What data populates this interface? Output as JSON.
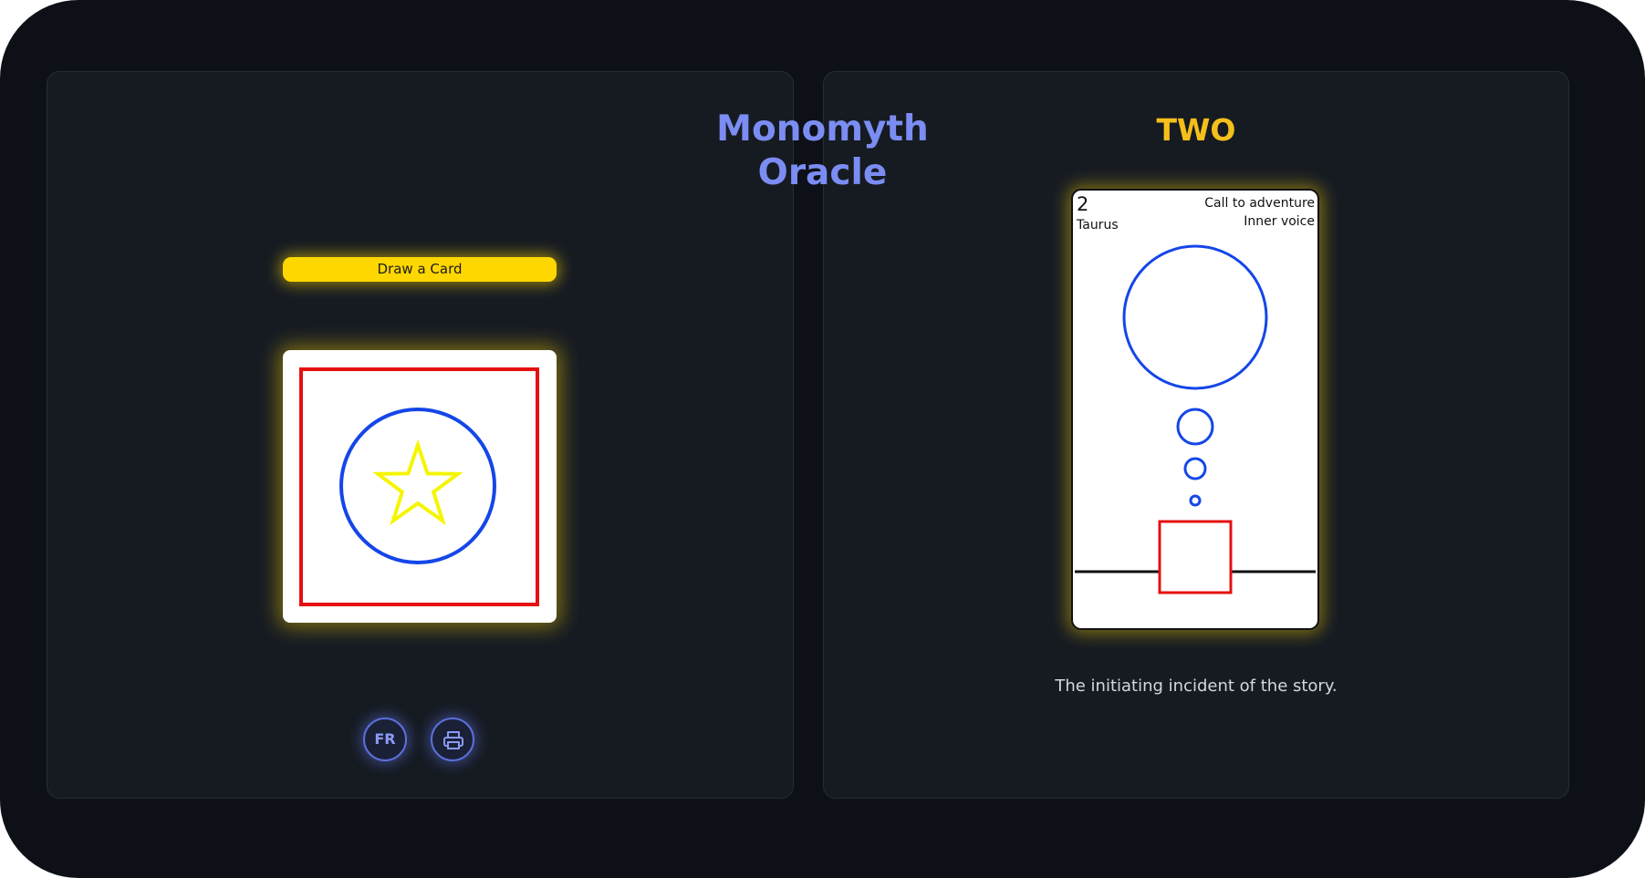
{
  "app": {
    "title_line1": "Monomyth",
    "title_line2": "Oracle",
    "draw_button_label": "Draw a Card",
    "card_back_icon": "star-in-circle-in-square",
    "lang_button_label": "FR",
    "print_icon": "printer-icon"
  },
  "drawn_card": {
    "title": "TWO",
    "number": "2",
    "sign": "Taurus",
    "stage": "Call to adventure",
    "aspect": "Inner voice",
    "description": "The initiating incident of the story."
  },
  "colors": {
    "background": "#0d1117",
    "panel": "#161b22",
    "title_accent": "#7b8df2",
    "card_title_accent": "#f5bf1b",
    "button_yellow": "#ffd700",
    "art_blue": "#1446e8",
    "art_red": "#e51010",
    "art_yellow": "#f5f500"
  }
}
